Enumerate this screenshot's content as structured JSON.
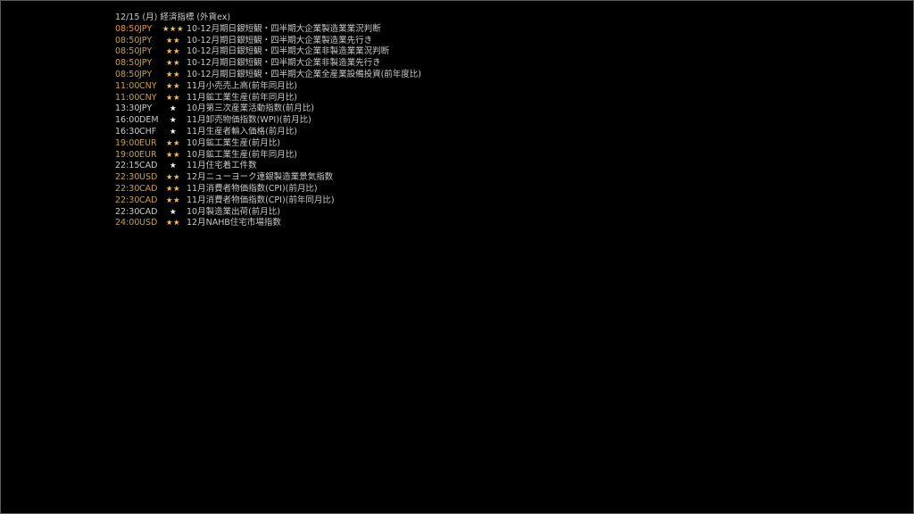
{
  "header": "12/15 (月) 経済指標 (外貨ex)",
  "events": [
    {
      "time": "08:50",
      "currency": "JPY",
      "stars": "★★★",
      "title": "10-12月期日銀短観・四半期大企業製造業業況判断",
      "tone": "high"
    },
    {
      "time": "08:50",
      "currency": "JPY",
      "stars": "★★",
      "title": "10-12月期日銀短観・四半期大企業製造業先行き",
      "tone": "med"
    },
    {
      "time": "08:50",
      "currency": "JPY",
      "stars": "★★",
      "title": "10-12月期日銀短観・四半期大企業非製造業業況判断",
      "tone": "med"
    },
    {
      "time": "08:50",
      "currency": "JPY",
      "stars": "★★",
      "title": "10-12月期日銀短観・四半期大企業非製造業先行き",
      "tone": "med"
    },
    {
      "time": "08:50",
      "currency": "JPY",
      "stars": "★★",
      "title": "10-12月期日銀短観・四半期大企業全産業設備投資(前年度比)",
      "tone": "med"
    },
    {
      "time": "11:00",
      "currency": "CNY",
      "stars": "★★",
      "title": "11月小売売上高(前年同月比)",
      "tone": "med"
    },
    {
      "time": "11:00",
      "currency": "CNY",
      "stars": "★★",
      "title": "11月鉱工業生産(前年同月比)",
      "tone": "med"
    },
    {
      "time": "13:30",
      "currency": "JPY",
      "stars": "★",
      "title": "10月第三次産業活動指数(前月比)",
      "tone": "norm"
    },
    {
      "time": "16:00",
      "currency": "DEM",
      "stars": "★",
      "title": "11月卸売物価指数(WPI)(前月比)",
      "tone": "norm"
    },
    {
      "time": "16:30",
      "currency": "CHF",
      "stars": "★",
      "title": "11月生産者輸入価格(前月比)",
      "tone": "norm"
    },
    {
      "time": "19:00",
      "currency": "EUR",
      "stars": "★★",
      "title": "10月鉱工業生産(前月比)",
      "tone": "med"
    },
    {
      "time": "19:00",
      "currency": "EUR",
      "stars": "★★",
      "title": "10月鉱工業生産(前年同月比)",
      "tone": "med"
    },
    {
      "time": "22:15",
      "currency": "CAD",
      "stars": "★",
      "title": "11月住宅着工件数",
      "tone": "norm"
    },
    {
      "time": "22:30",
      "currency": "USD",
      "stars": "★★",
      "title": "12月ニューヨーク連銀製造業景気指数",
      "tone": "med"
    },
    {
      "time": "22:30",
      "currency": "CAD",
      "stars": "★★",
      "title": "11月消費者物価指数(CPI)(前月比)",
      "tone": "med"
    },
    {
      "time": "22:30",
      "currency": "CAD",
      "stars": "★★",
      "title": "11月消費者物価指数(CPI)(前年同月比)",
      "tone": "med"
    },
    {
      "time": "22:30",
      "currency": "CAD",
      "stars": "★",
      "title": "10月製造業出荷(前月比)",
      "tone": "norm"
    },
    {
      "time": "24:00",
      "currency": "USD",
      "stars": "★★",
      "title": "12月NAHB住宅市場指数",
      "tone": "med"
    }
  ],
  "colors": {
    "background": "#000000",
    "high_importance": "#e8942a",
    "medium_importance": "#c9a13c",
    "normal": "#c8c8c8",
    "star_gold": "#f0c050",
    "star_white": "#ffffff"
  }
}
